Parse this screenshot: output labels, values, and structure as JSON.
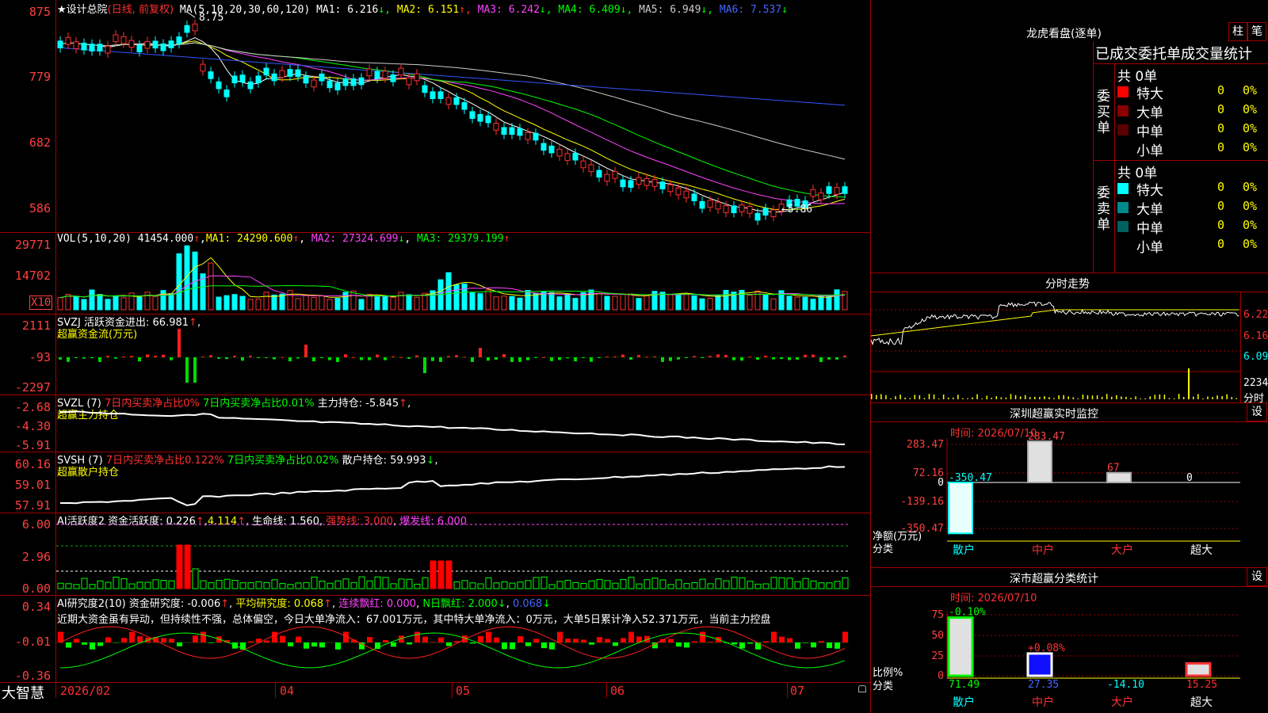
{
  "main": {
    "title": "★设计总院",
    "mode": "(日线, 前复权)",
    "ma_params": "MA(5,10,20,30,60,120)",
    "ma": [
      {
        "label": "MA1:",
        "value": "6.216",
        "arrow": "↓",
        "color": "#ffffff"
      },
      {
        "label": "MA2:",
        "value": "6.151",
        "arrow": "↑",
        "color": "#ffff00"
      },
      {
        "label": "MA3:",
        "value": "6.242",
        "arrow": "↓",
        "color": "#ff44ff"
      },
      {
        "label": "MA4:",
        "value": "6.409",
        "arrow": "↓",
        "color": "#00ff00"
      },
      {
        "label": "MA5:",
        "value": "6.949",
        "arrow": "↓",
        "color": "#cccccc"
      },
      {
        "label": "MA6:",
        "value": "7.537",
        "arrow": "↓",
        "color": "#4466ff"
      }
    ],
    "ticks": [
      "875",
      "779",
      "682",
      "586"
    ],
    "high_label": "8.75",
    "low_label": "5.86"
  },
  "vol": {
    "title": "VOL(5,10,20)",
    "value": "41454.000",
    "ma1": "MA1: 24290.600",
    "ma2": "MA2: 27324.699",
    "ma3": "MA3: 29379.199",
    "ticks": [
      "29771",
      "14702"
    ],
    "unit": "X10"
  },
  "svzj": {
    "title": "SVZJ  活跃资金进出: 66.981",
    "sub": "超赢资金流(万元)",
    "ticks": [
      "2111",
      "-93",
      "-2297"
    ]
  },
  "svzl": {
    "title": "SVZL (7)",
    "t1": "7日内买卖净占比0%",
    "t2": "7日内买卖净占比0.01%",
    "t3": "主力持仓: -5.845",
    "sub": "超赢主力持仓",
    "ticks": [
      "-2.68",
      "-4.30",
      "-5.91"
    ]
  },
  "svsh": {
    "title": "SVSH (7)",
    "t1": "7日内买卖净占比0.122%",
    "t2": "7日内买卖净占比0.02%",
    "t3": "散户持仓: 59.993",
    "sub": "超赢散户持仓",
    "ticks": [
      "60.16",
      "59.01",
      "57.91"
    ]
  },
  "ai1": {
    "title": "AI活跃度2 资金活跃度: 0.226",
    "v2": "4.114",
    "life": "生命线: 1.560",
    "strong": "强势线: 3.000",
    "burst": "爆发线: 6.000",
    "ticks": [
      "6.00",
      "2.96",
      "0.00"
    ]
  },
  "ai2": {
    "title": "AI研究度2(10) 资金研究度: -0.006",
    "avg": "平均研究度: 0.068",
    "lianxu": "连续飘红: 0.000",
    "nday": "N日飘红: 2.000",
    "last": "0.068",
    "comment": "近期大资金虽有异动，但持续性不强，总体偏空，今日大单净流入：67.001万元，其中特大单净流入：0万元，大单5日累计净入52.371万元，当前主力控盘",
    "ticks": [
      "0.34",
      "-0.01",
      "-0.36"
    ]
  },
  "xaxis": {
    "brand": "大智慧",
    "labels": [
      "2026/02",
      "04",
      "05",
      "06",
      "07"
    ]
  },
  "dragon": {
    "title": "龙虎看盘(逐单)",
    "btn1": "柱",
    "btn2": "笔",
    "tabs": "已成交委托单成交量统计",
    "buy_label": "委买单",
    "sell_label": "委卖单",
    "buy_total": "共 0单",
    "sell_total": "共 0单",
    "buy_rows": [
      {
        "name": "特大",
        "n": "0",
        "p": "0%",
        "color": "#ff0000"
      },
      {
        "name": "大单",
        "n": "0",
        "p": "0%",
        "color": "#8b0000"
      },
      {
        "name": "中单",
        "n": "0",
        "p": "0%",
        "color": "#5a0000"
      },
      {
        "name": "小单",
        "n": "0",
        "p": "0%",
        "color": "#000000"
      }
    ],
    "sell_rows": [
      {
        "name": "特大",
        "n": "0",
        "p": "0%",
        "color": "#00ffff"
      },
      {
        "name": "大单",
        "n": "0",
        "p": "0%",
        "color": "#008b8b"
      },
      {
        "name": "中单",
        "n": "0",
        "p": "0%",
        "color": "#006060"
      },
      {
        "name": "小单",
        "n": "0",
        "p": "0%",
        "color": "#000000"
      }
    ]
  },
  "intraday": {
    "title": "分时走势",
    "ticks": [
      "6.22",
      "6.16",
      "6.09"
    ],
    "vol_tick": "2234",
    "vol_unit": "分时"
  },
  "monitor": {
    "title": "深圳超赢实时监控",
    "btn": "设",
    "time": "时间: 2026/07/10",
    "ticks": [
      "283.47",
      "72.16",
      "0",
      "-139.16",
      "-350.47"
    ],
    "ylabel": "净额(万元)",
    "xlabel": "分类",
    "cats": [
      "散户",
      "中户",
      "大户",
      "超大"
    ],
    "values": [
      -350.47,
      283.47,
      67,
      0
    ],
    "value_labels": [
      "-350.47",
      "283.47",
      "67",
      "0"
    ]
  },
  "classify": {
    "title": "深市超赢分类统计",
    "btn": "设",
    "time": "时间: 2026/07/10",
    "ticks": [
      "75",
      "50",
      "25",
      "0"
    ],
    "ylabel": "比例%",
    "xlabel": "分类",
    "cats": [
      "散户",
      "中户",
      "大户",
      "超大"
    ],
    "values": [
      71.49,
      27.35,
      14.1,
      15.25
    ],
    "value_labels": [
      "71.49",
      "27.35",
      "-14.10",
      "15.25"
    ],
    "top_labels": [
      "-0.10%",
      "+0.08%",
      "",
      ""
    ]
  }
}
